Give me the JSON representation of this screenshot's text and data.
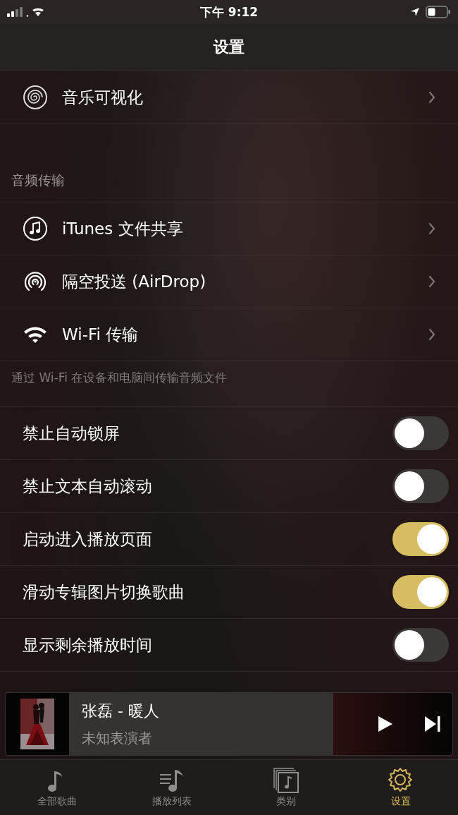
{
  "status_bar": {
    "time": "下午 9:12"
  },
  "nav": {
    "title": "设置"
  },
  "groups": [
    {
      "items": [
        {
          "label": "音乐可视化",
          "kind": "link"
        }
      ]
    },
    {
      "header": "音频传输",
      "footer": "通过 Wi-Fi 在设备和电脑间传输音频文件",
      "items": [
        {
          "label": "iTunes 文件共享",
          "kind": "link"
        },
        {
          "label": "隔空投送 (AirDrop)",
          "kind": "link"
        },
        {
          "label": "Wi-Fi 传输",
          "kind": "link"
        }
      ]
    },
    {
      "items": [
        {
          "label": "禁止自动锁屏",
          "kind": "toggle",
          "on": false
        },
        {
          "label": "禁止文本自动滚动",
          "kind": "toggle",
          "on": false
        },
        {
          "label": "启动进入播放页面",
          "kind": "toggle",
          "on": true
        },
        {
          "label": "滑动专辑图片切换歌曲",
          "kind": "toggle",
          "on": true
        },
        {
          "label": "显示剩余播放时间",
          "kind": "toggle",
          "on": false
        }
      ]
    }
  ],
  "now_playing": {
    "title": "张磊 - 暖人",
    "artist": "未知表演者"
  },
  "tabs": [
    {
      "label": "全部歌曲",
      "selected": false
    },
    {
      "label": "播放列表",
      "selected": false
    },
    {
      "label": "类别",
      "selected": false
    },
    {
      "label": "设置",
      "selected": true
    }
  ]
}
